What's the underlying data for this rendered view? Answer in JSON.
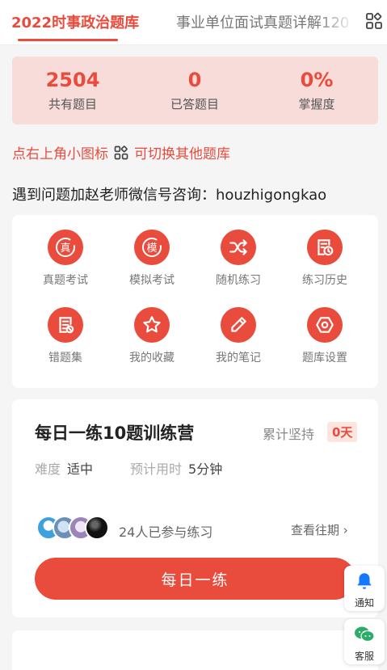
{
  "header": {
    "active_tab": "2022时事政治题库",
    "inactive_tab": "事业单位面试真题详解120",
    "switch_icon": "grid-icon"
  },
  "stats": [
    {
      "value": "2504",
      "label": "共有题目"
    },
    {
      "value": "0",
      "label": "已答题目"
    },
    {
      "value": "0%",
      "label": "掌握度"
    }
  ],
  "hint": {
    "before": "点右上角小图标",
    "after": "可切换其他题库"
  },
  "contact": "遇到问题加赵老师微信号咨询：houzhigongkao",
  "menu": [
    {
      "label": "真题考试",
      "icon": "real-exam-icon",
      "glyph": "真"
    },
    {
      "label": "模拟考试",
      "icon": "mock-exam-icon",
      "glyph": "模"
    },
    {
      "label": "随机练习",
      "icon": "shuffle-icon"
    },
    {
      "label": "练习历史",
      "icon": "history-icon"
    },
    {
      "label": "错题集",
      "icon": "wrong-questions-icon"
    },
    {
      "label": "我的收藏",
      "icon": "star-icon"
    },
    {
      "label": "我的笔记",
      "icon": "pencil-icon"
    },
    {
      "label": "题库设置",
      "icon": "settings-icon"
    }
  ],
  "camp": {
    "title": "每日一练10题训练营",
    "persist_label": "累计坚持",
    "persist_value": "0天",
    "difficulty_label": "难度",
    "difficulty_value": "适中",
    "time_label": "预计用时",
    "time_value": "5分钟",
    "participants": "24人已参与练习",
    "history_link": "查看往期",
    "button": "每日一练"
  },
  "floating": {
    "notify": "通知",
    "service": "客服"
  },
  "colors": {
    "accent": "#e94b3c",
    "stats_bg": "#f8dcd9",
    "badge_bg": "#fde4df",
    "wechat": "#2aae67",
    "bell": "#1677ff"
  }
}
